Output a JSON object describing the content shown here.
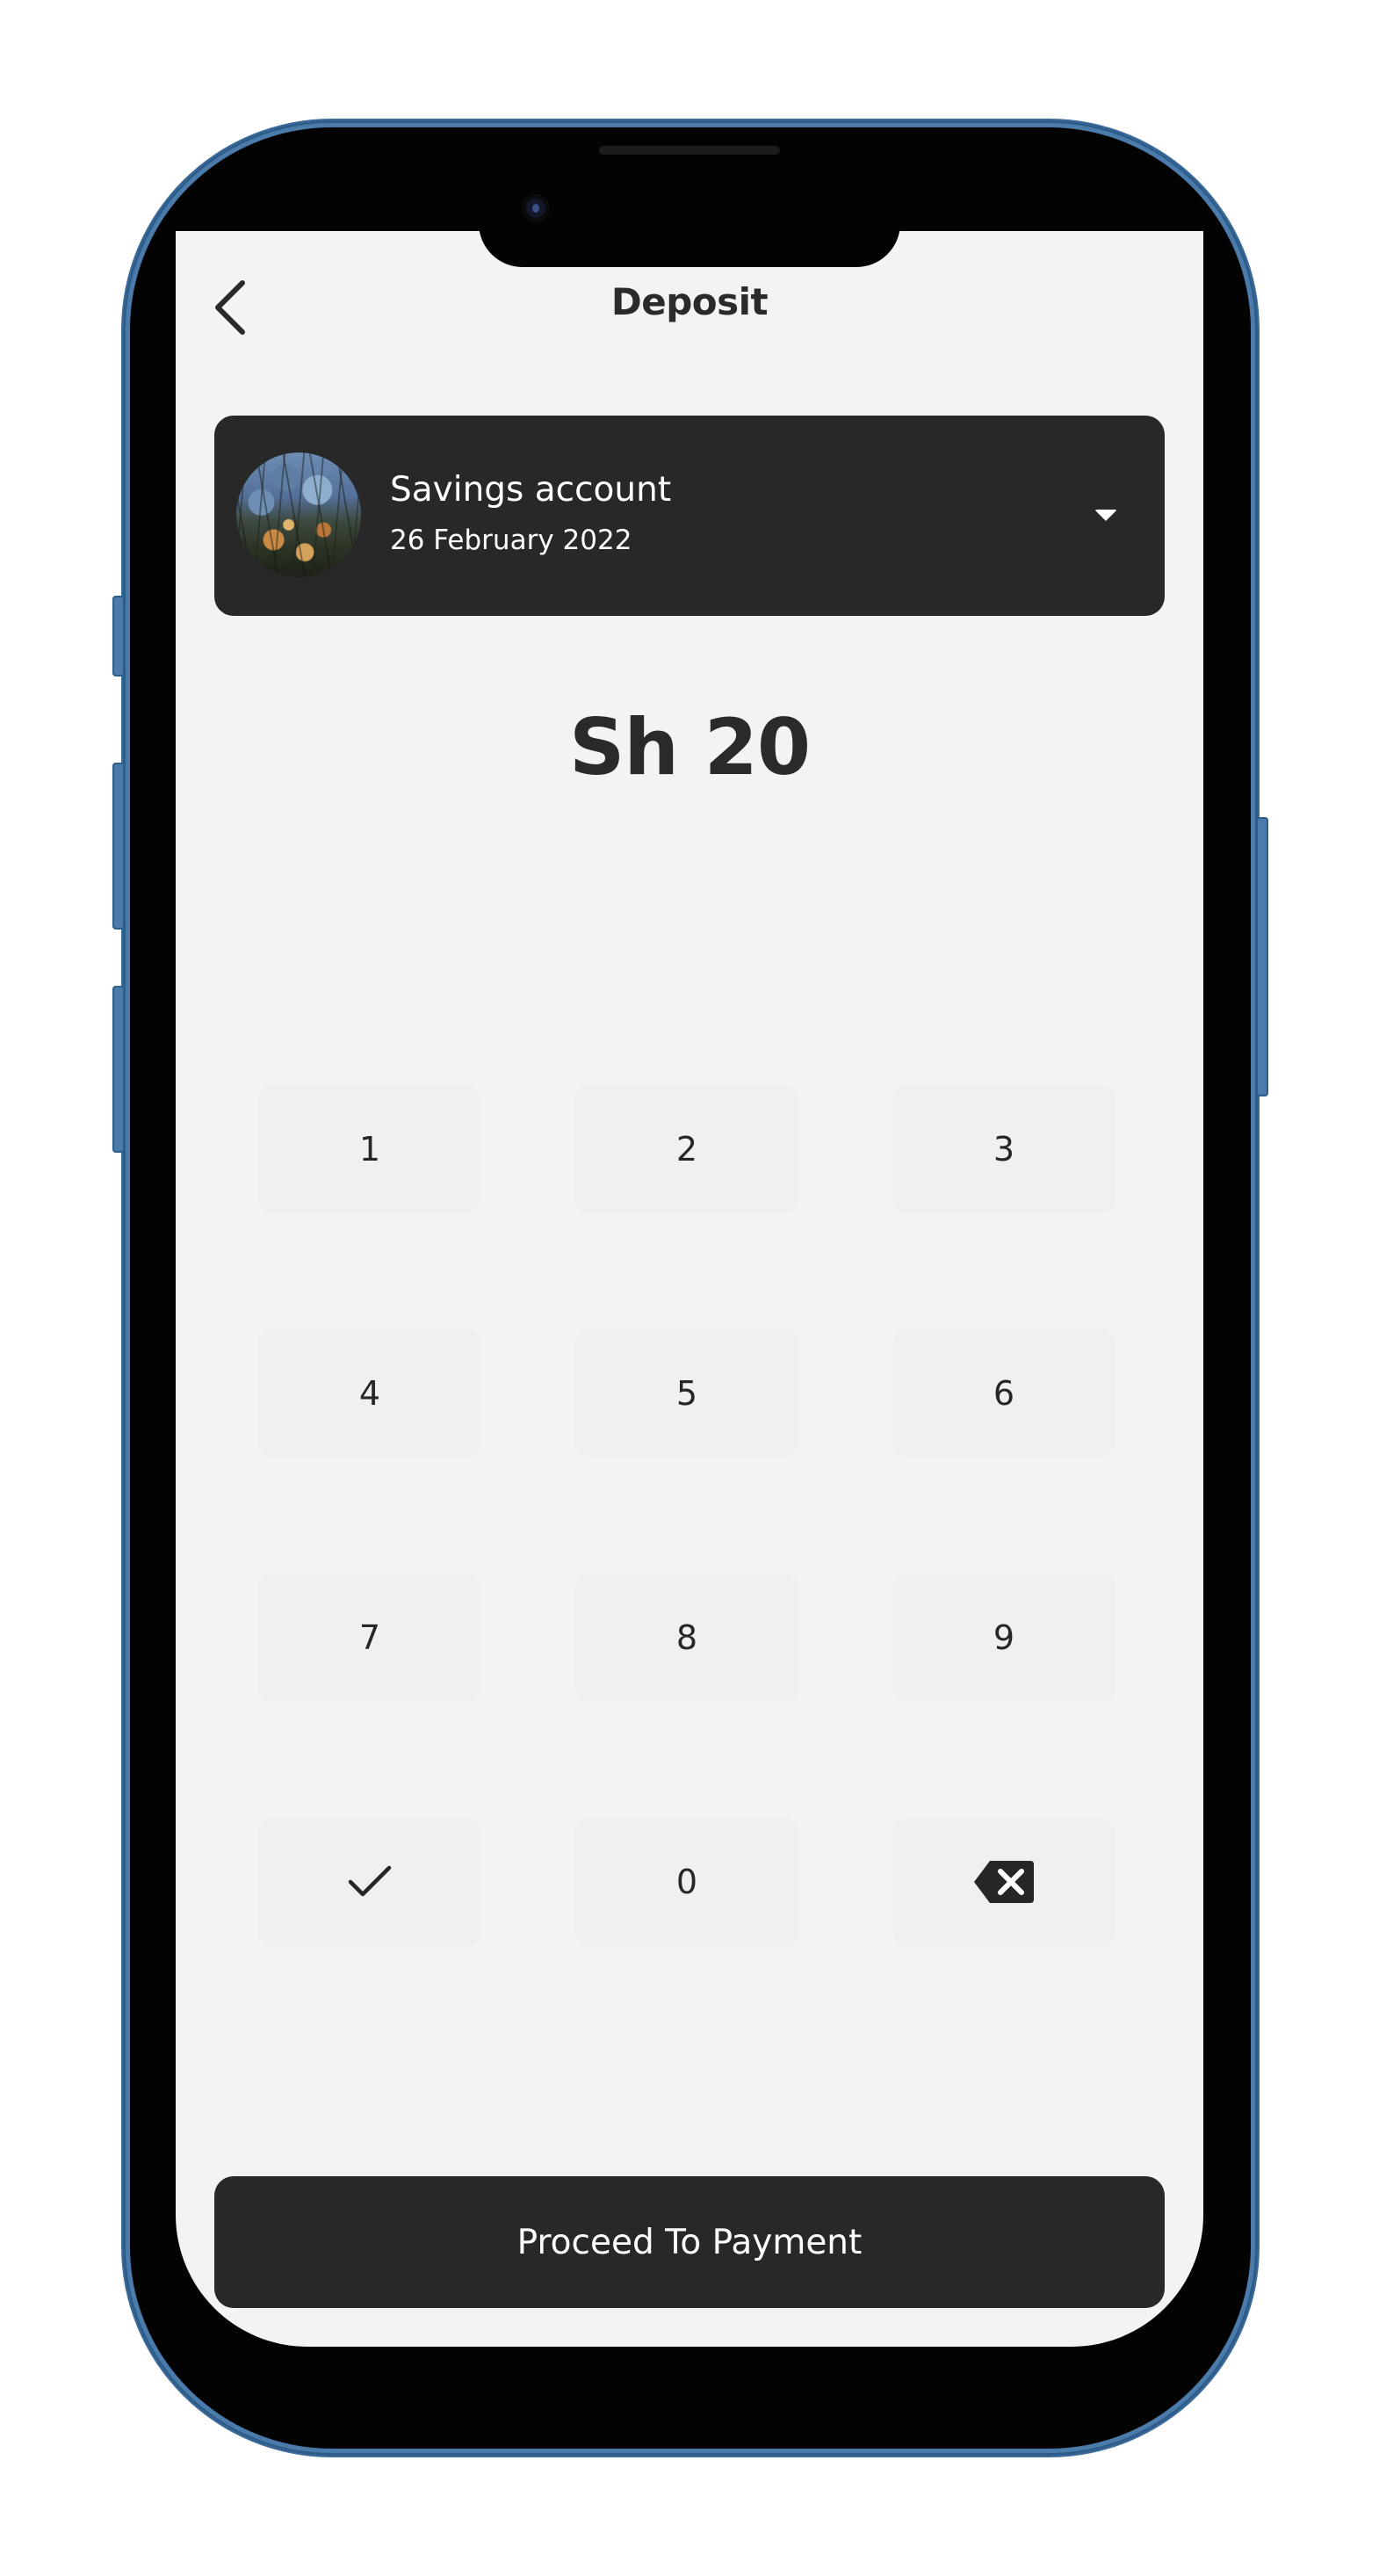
{
  "header": {
    "title": "Deposit",
    "back_icon": "chevron-left-icon"
  },
  "account": {
    "name": "Savings account",
    "date": "26 February 2022",
    "dropdown_icon": "caret-down-icon"
  },
  "amount": {
    "display": "Sh 20"
  },
  "keypad": {
    "keys": [
      "1",
      "2",
      "3",
      "4",
      "5",
      "6",
      "7",
      "8",
      "9",
      "",
      "0",
      ""
    ],
    "confirm_icon": "check-icon",
    "delete_icon": "backspace-icon"
  },
  "footer": {
    "proceed_label": "Proceed To Payment"
  },
  "colors": {
    "frame": "#4a7bab",
    "screen_bg": "#f3f3f3",
    "dark": "#282828",
    "key_bg": "#f0f0f0",
    "text": "#2a2a2a"
  }
}
